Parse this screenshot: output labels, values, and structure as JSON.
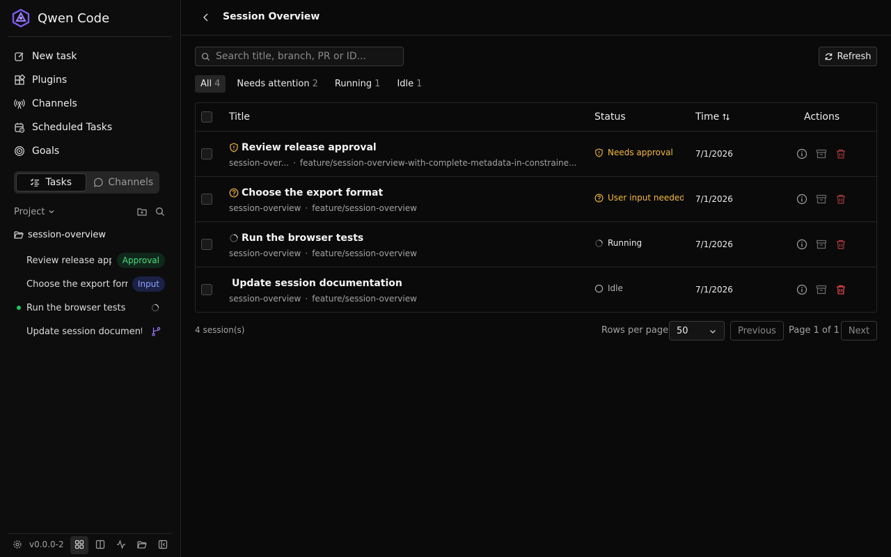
{
  "app": {
    "name": "Qwen Code",
    "version": "v0.0.0-2"
  },
  "nav": [
    {
      "label": "New task",
      "icon": "edit-icon"
    },
    {
      "label": "Plugins",
      "icon": "plugins-icon"
    },
    {
      "label": "Channels",
      "icon": "broadcast-icon"
    },
    {
      "label": "Scheduled Tasks",
      "icon": "calendar-clock-icon"
    },
    {
      "label": "Goals",
      "icon": "target-icon"
    }
  ],
  "sidebar_tabs": {
    "tasks": "Tasks",
    "channels": "Channels",
    "active": "Tasks"
  },
  "project": {
    "label": "Project",
    "folder": "session-overview",
    "tasks": [
      {
        "title": "Review release approval",
        "badge": "Approval",
        "status": "approval"
      },
      {
        "title": "Choose the export format",
        "badge": "Input",
        "status": "input"
      },
      {
        "title": "Run the browser tests",
        "status": "running"
      },
      {
        "title": "Update session documentation",
        "status": "branch"
      }
    ]
  },
  "header": {
    "title": "Session Overview"
  },
  "search": {
    "placeholder": "Search title, branch, PR or ID...",
    "value": ""
  },
  "refresh_label": "Refresh",
  "filters": [
    {
      "label": "All",
      "count": "4",
      "active": true
    },
    {
      "label": "Needs attention",
      "count": "2"
    },
    {
      "label": "Running",
      "count": "1"
    },
    {
      "label": "Idle",
      "count": "1"
    }
  ],
  "table": {
    "columns": {
      "title": "Title",
      "status": "Status",
      "time": "Time",
      "actions": "Actions"
    },
    "rows": [
      {
        "title": "Review release approval",
        "project": "session-over...",
        "branch": "feature/session-overview-with-complete-metadata-in-constraine...",
        "status": "Needs approval",
        "status_kind": "approval",
        "time": "7/1/2026"
      },
      {
        "title": "Choose the export format",
        "project": "session-overview",
        "branch": "feature/session-overview",
        "status": "User input needed",
        "status_kind": "input",
        "time": "7/1/2026"
      },
      {
        "title": "Run the browser tests",
        "project": "session-overview",
        "branch": "feature/session-overview",
        "status": "Running",
        "status_kind": "running",
        "time": "7/1/2026"
      },
      {
        "title": "Update session documentation",
        "project": "session-overview",
        "branch": "feature/session-overview",
        "status": "Idle",
        "status_kind": "idle",
        "time": "7/1/2026"
      }
    ]
  },
  "footer": {
    "count": "4 session(s)",
    "rows_per_page_label": "Rows per page",
    "rows_per_page": "50",
    "previous": "Previous",
    "page_info": "Page 1 of 1",
    "next": "Next"
  },
  "colors": {
    "background": "#0a0a0a",
    "warning": "#f5b93a",
    "danger": "#e5484d",
    "success": "#22c55e",
    "accent": "#8b5cf6"
  }
}
